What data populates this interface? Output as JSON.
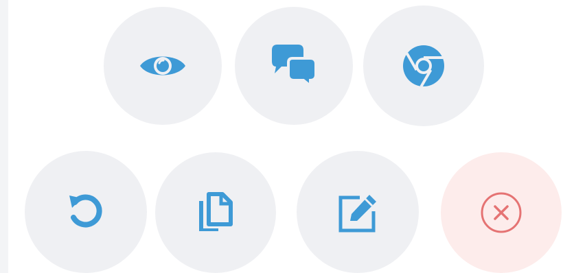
{
  "theme": {
    "page_bg": "#ffffff",
    "button_bg": "#eff0f3",
    "danger_button_bg": "#fdeceb",
    "icon_blue": "#3e9ad6",
    "icon_red": "#e57373"
  },
  "action_panel": {
    "top_row": [
      {
        "action": "view",
        "icon": "eye-icon"
      },
      {
        "action": "chat",
        "icon": "chat-bubbles-icon"
      },
      {
        "action": "open-in-chrome",
        "icon": "chrome-icon"
      }
    ],
    "bottom_row": [
      {
        "action": "refresh",
        "icon": "undo-arrow-icon"
      },
      {
        "action": "copy",
        "icon": "copy-icon"
      },
      {
        "action": "edit",
        "icon": "edit-icon"
      },
      {
        "action": "close",
        "icon": "close-circle-icon"
      }
    ]
  }
}
